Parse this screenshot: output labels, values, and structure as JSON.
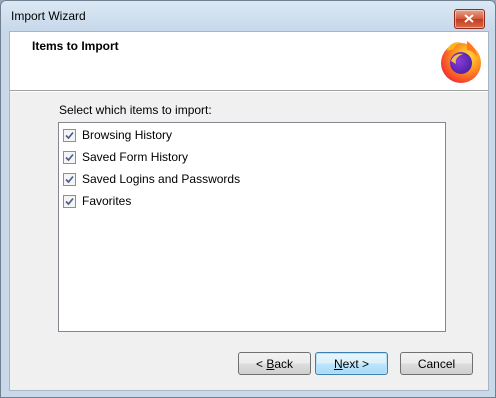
{
  "window": {
    "title": "Import Wizard"
  },
  "header": {
    "title": "Items to Import",
    "logo_icon": "firefox-logo-icon"
  },
  "content": {
    "prompt": "Select which items to import:",
    "items": [
      {
        "label": "Browsing History",
        "checked": true
      },
      {
        "label": "Saved Form History",
        "checked": true
      },
      {
        "label": "Saved Logins and Passwords",
        "checked": true
      },
      {
        "label": "Favorites",
        "checked": true
      }
    ]
  },
  "buttons": {
    "back": {
      "prefix": "< ",
      "accel": "B",
      "rest": "ack"
    },
    "next": {
      "accel": "N",
      "rest": "ext >"
    },
    "cancel": "Cancel"
  },
  "colors": {
    "accent": "#3c7fb1",
    "close": "#c63a1c",
    "frame": "#c9d9ea"
  }
}
